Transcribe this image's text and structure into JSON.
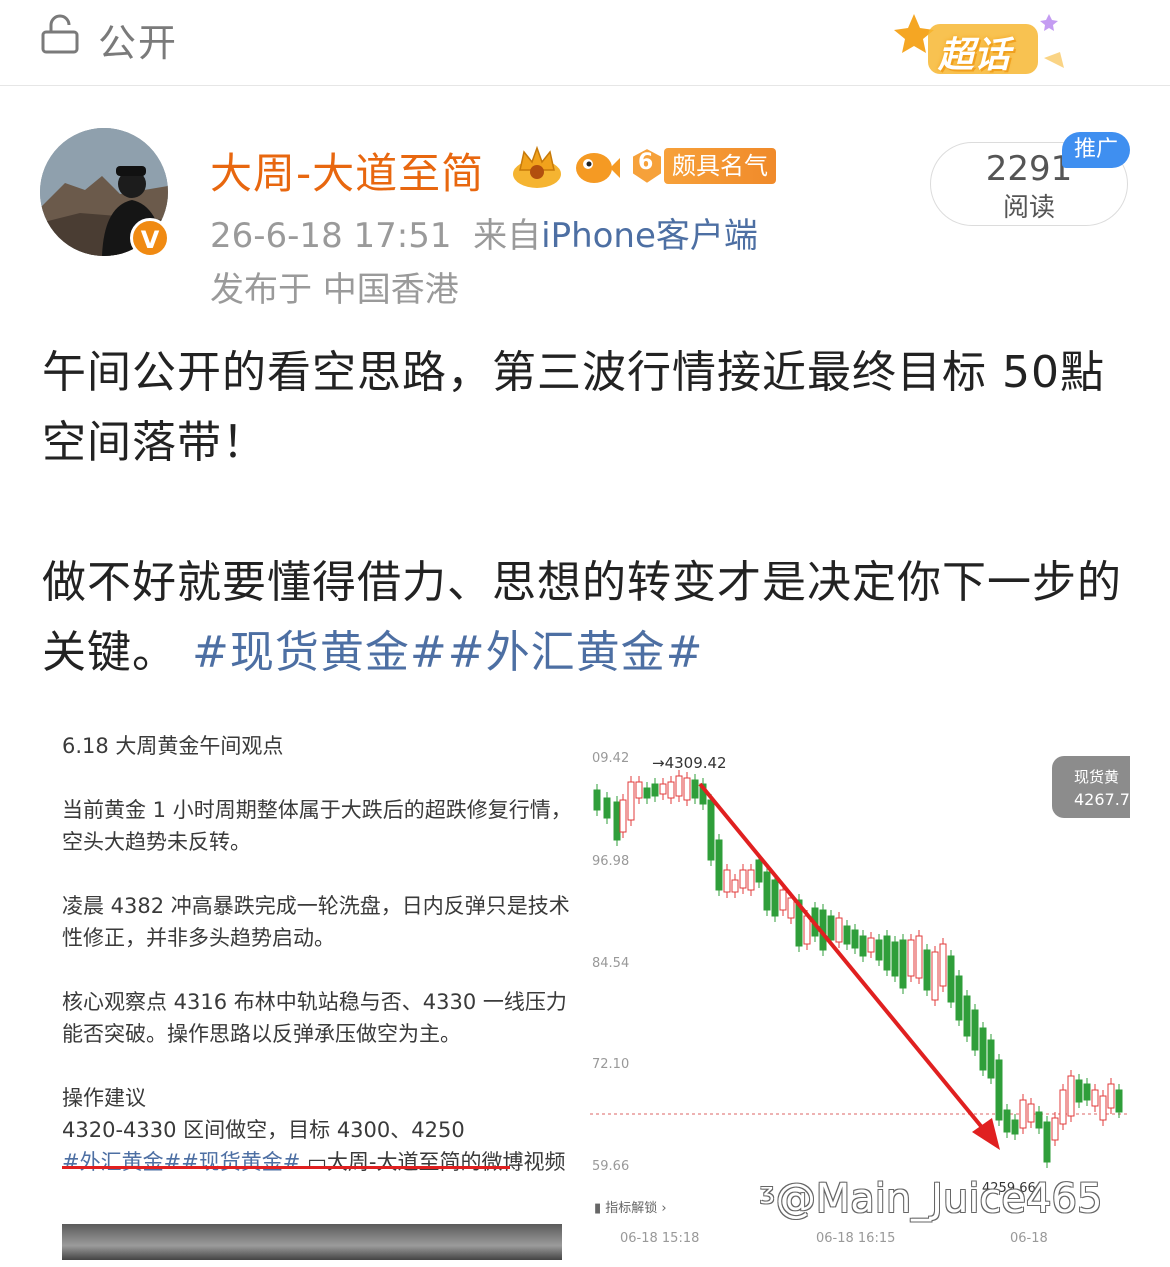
{
  "topbar": {
    "visibility_label": "公开",
    "supertopic_label": "超话"
  },
  "user": {
    "name": "大周-大道至简",
    "verified_badge": "V",
    "fame_level": "6",
    "fame_label": "颇具名气",
    "timestamp": "26-6-18 17:51",
    "source_prefix": "来自",
    "source": "iPhone客户端",
    "location": "发布于 中国香港"
  },
  "reads": {
    "count": "2291",
    "label": "阅读",
    "promo": "推广"
  },
  "post": {
    "line1": "午间公开的看空思路，第三波行情接近最终目标 50點空间落带！",
    "line2": "做不好就要懂得借力、思想的转变才是决定你下一步的关键。",
    "hashtags": "#现货黄金##外汇黄金#"
  },
  "embed": {
    "note": {
      "title": "6.18 大周黄金午间观点",
      "p1": "当前黄金 1 小时周期整体属于大跌后的超跌修复行情，空头大趋势未反转。",
      "p2": "凌晨 4382 冲高暴跌完成一轮洗盘，日内反弹只是技术性修正，并非多头趋势启动。",
      "p3": "核心观察点 4316 布林中轨站稳与否、4330 一线压力能否突破。操作思路以反弹承压做空为主。",
      "advice_title": "操作建议",
      "advice": "4320-4330 区间做空，目标 4300、4250",
      "tags": "#外汇黄金##现货黄金#",
      "source_link": "大周-大道至简的微博视频"
    },
    "chart": {
      "price_pill_label": "现货黄",
      "price_pill_value": "4267.7",
      "y_ticks": [
        "09.42",
        "96.98",
        "84.54",
        "72.10",
        "59.66"
      ],
      "high_label": "4309.42",
      "low_label": "4259.66",
      "x_ticks": [
        "06-18 15:18",
        "06-18 16:15",
        "06-18"
      ],
      "indicator_button": "指标解锁",
      "colors": {
        "up": "#e23b3b",
        "down": "#2f9e3a",
        "arrow": "#e02020"
      }
    }
  },
  "watermark": "@Main_Juice465"
}
